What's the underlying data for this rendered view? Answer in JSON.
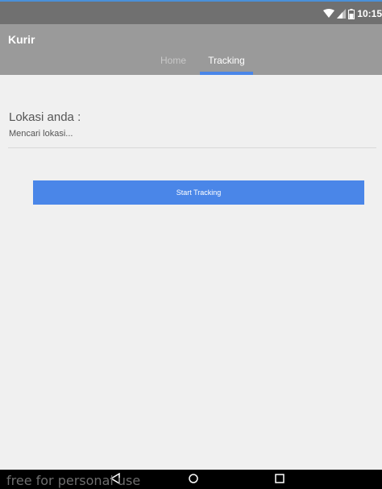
{
  "status_bar": {
    "time": "10:15",
    "icons": [
      "wifi-icon",
      "signal-icon",
      "battery-icon"
    ]
  },
  "app_bar": {
    "title": "Kurir",
    "tabs": [
      {
        "label": "Home",
        "selected": false
      },
      {
        "label": "Tracking",
        "selected": true
      }
    ]
  },
  "content": {
    "location_label": "Lokasi anda :",
    "location_value": "Mencari lokasi...",
    "start_button_label": "Start Tracking"
  },
  "nav_bar": {
    "buttons": [
      "back-icon",
      "home-icon",
      "recents-icon"
    ]
  },
  "watermark": "free for personal use",
  "colors": {
    "status_bar": "#707070",
    "app_bar": "#9a9a9a",
    "accent": "#4a86e8",
    "background": "#f0f0f0"
  }
}
